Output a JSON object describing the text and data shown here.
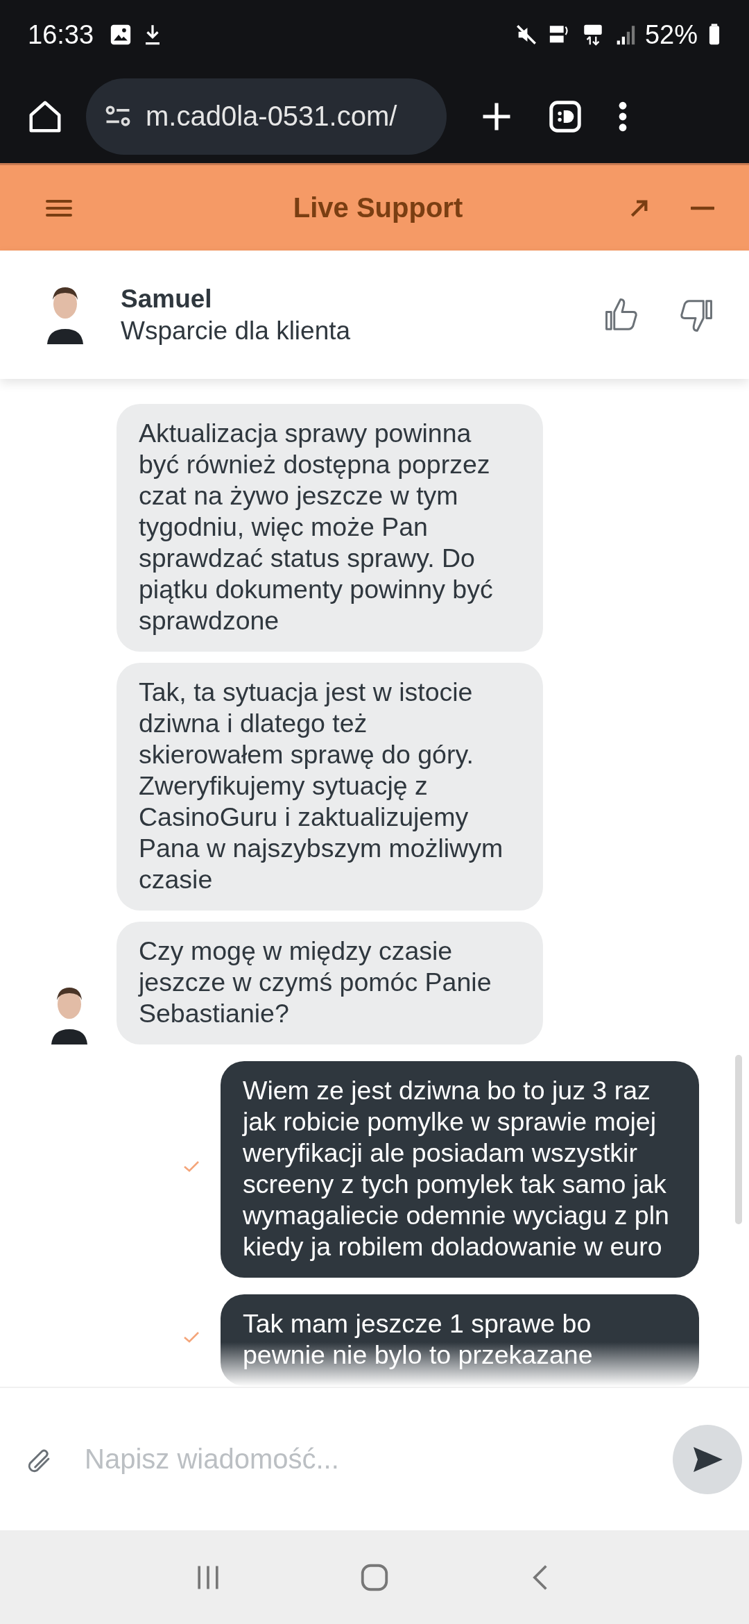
{
  "status_bar": {
    "time": "16:33",
    "battery": "52%"
  },
  "browser": {
    "url": "m.cad0la-0531.com/"
  },
  "header": {
    "title": "Live Support"
  },
  "agent": {
    "name": "Samuel",
    "role": "Wsparcie dla klienta"
  },
  "messages": [
    {
      "kind": "agent",
      "avatar": false,
      "text": "Aktualizacja sprawy powinna być również dostępna poprzez czat na żywo jeszcze w tym tygodniu, więc może Pan sprawdzać status sprawy. Do piątku dokumenty powinny być sprawdzone"
    },
    {
      "kind": "agent",
      "avatar": false,
      "text": "Tak, ta sytuacja jest w istocie dziwna i dlatego też skierowałem sprawę do góry. Zweryfikujemy sytuację z CasinoGuru i zaktualizujemy Pana w najszybszym możliwym czasie"
    },
    {
      "kind": "agent",
      "avatar": true,
      "text": "Czy mogę w między czasie jeszcze w czymś pomóc Panie Sebastianie?"
    },
    {
      "kind": "user",
      "delivered": true,
      "text": "Wiem ze jest dziwna bo to juz 3 raz jak robicie pomylke w sprawie mojej weryfikacji ale posiadam wszystkir screeny z tych pomylek tak samo jak wymagaliecie odemnie wyciagu z pln kiedy ja robilem doladowanie w euro"
    },
    {
      "kind": "user",
      "delivered": true,
      "text": "Tak mam jeszcze 1 sprawe bo pewnie nie bylo to przekazane"
    }
  ],
  "composer": {
    "placeholder": "Napisz wiadomość..."
  }
}
